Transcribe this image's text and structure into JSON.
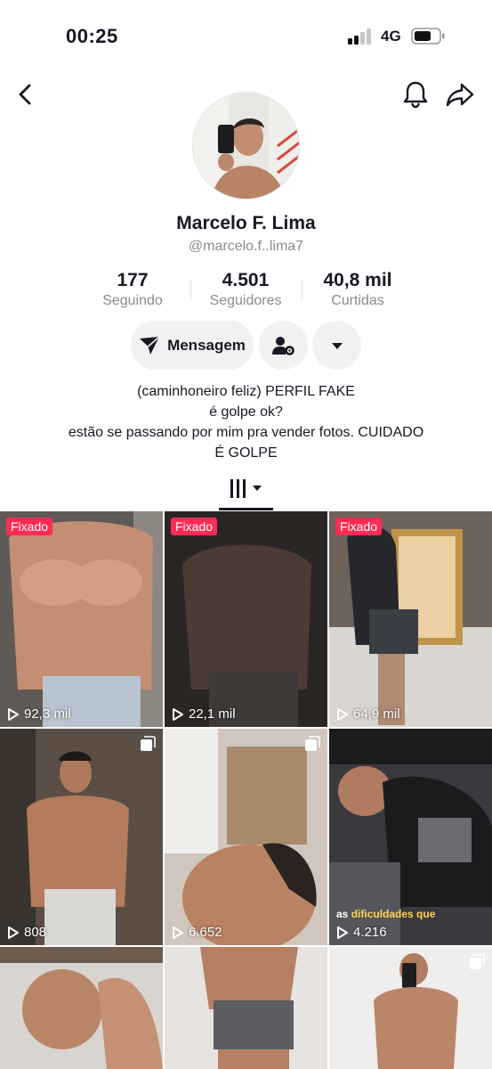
{
  "status_bar": {
    "time": "00:25",
    "network": "4G"
  },
  "icons": {
    "back": "chevron-left-icon",
    "bell": "bell-icon",
    "share": "share-arrow-icon",
    "message": "paper-plane-icon",
    "add_friend": "person-settings-icon",
    "more": "caret-down-icon",
    "tab": "videos-grid-icon",
    "play": "play-icon",
    "multi": "multi-photo-icon"
  },
  "profile": {
    "name": "Marcelo F. Lima",
    "handle": "@marcelo.f..lima7"
  },
  "stats": [
    {
      "value": "177",
      "label": "Seguindo"
    },
    {
      "value": "4.501",
      "label": "Seguidores"
    },
    {
      "value": "40,8 mil",
      "label": "Curtidas"
    }
  ],
  "actions": {
    "message_label": "Mensagem"
  },
  "bio": {
    "lines": [
      "(caminhoneiro feliz) PERFIL FAKE",
      "é golpe ok?",
      "estão se passando por mim pra vender fotos. CUIDADO",
      "É GOLPE"
    ]
  },
  "colors": {
    "accent": "#fe2c55",
    "text": "#161823",
    "muted": "#8a8b91",
    "button_bg": "#f1f1f2"
  },
  "videos": [
    {
      "pinned_label": "Fixado",
      "views": "92,3 mil"
    },
    {
      "pinned_label": "Fixado",
      "views": "22,1 mil"
    },
    {
      "pinned_label": "Fixado",
      "views": "64,9 mil"
    },
    {
      "views": "808"
    },
    {
      "views": "6.652"
    },
    {
      "views": "4.216",
      "caption_pre": "as",
      "caption_post": "dificuldades que"
    },
    {},
    {},
    {}
  ]
}
